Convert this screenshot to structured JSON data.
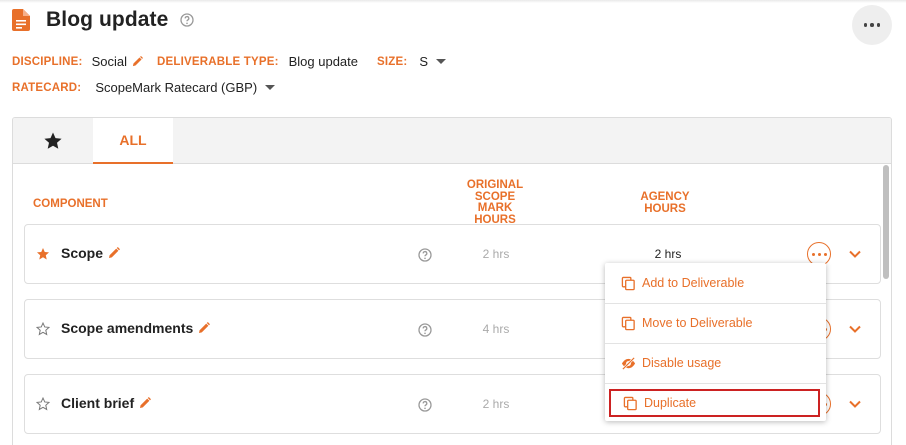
{
  "header": {
    "title": "Blog update"
  },
  "meta": {
    "discipline_label": "DISCIPLINE:",
    "discipline_value": "Social",
    "deliverable_type_label": "DELIVERABLE TYPE:",
    "deliverable_type_value": "Blog update",
    "size_label": "SIZE:",
    "size_value": "S",
    "ratecard_label": "RATECARD:",
    "ratecard_value": "ScopeMark Ratecard (GBP)"
  },
  "tabs": {
    "all_label": "ALL"
  },
  "columns": {
    "component": "COMPONENT",
    "original_line1": "ORIGINAL",
    "original_line2": "SCOPE",
    "original_line3": "MARK",
    "original_line4": "HOURS",
    "agency_line1": "AGENCY",
    "agency_line2": "HOURS"
  },
  "rows": [
    {
      "name": "Scope",
      "starred": true,
      "original_hours": "2 hrs",
      "agency_hours": "2 hrs"
    },
    {
      "name": "Scope amendments",
      "starred": false,
      "original_hours": "4 hrs",
      "agency_hours": ""
    },
    {
      "name": "Client brief",
      "starred": false,
      "original_hours": "2 hrs",
      "agency_hours": ""
    }
  ],
  "menu": {
    "items": [
      {
        "label": "Add to Deliverable",
        "icon": "copy-icon"
      },
      {
        "label": "Move to Deliverable",
        "icon": "copy-icon"
      },
      {
        "label": "Disable usage",
        "icon": "eye-off-icon"
      },
      {
        "label": "Duplicate",
        "icon": "copy-icon"
      }
    ]
  },
  "colors": {
    "accent": "#e8702a",
    "selected_outline": "#cc2222"
  }
}
